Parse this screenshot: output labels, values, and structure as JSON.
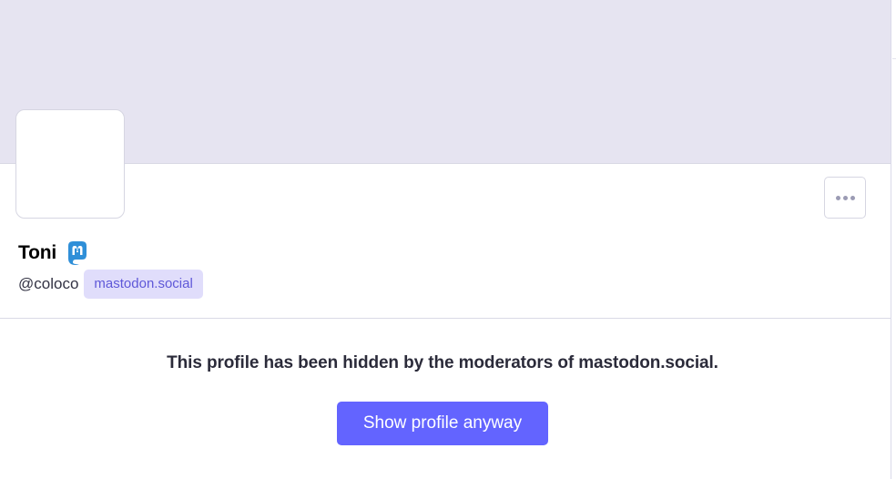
{
  "profile": {
    "display_name": "Toni",
    "handle": "@coloco",
    "domain": "mastodon.social",
    "badge_icon": "mastodon-logo-icon"
  },
  "actions": {
    "more_icon": "ellipsis-icon"
  },
  "notice": {
    "message": "This profile has been hidden by the moderators of mastodon.social.",
    "button_label": "Show profile anyway"
  },
  "colors": {
    "header_bg": "#e6e4f1",
    "accent": "#6364ff",
    "domain_pill_bg": "#e0ddfb",
    "domain_pill_text": "#5f58d8",
    "mastodon_blue": "#2f8fd8"
  }
}
